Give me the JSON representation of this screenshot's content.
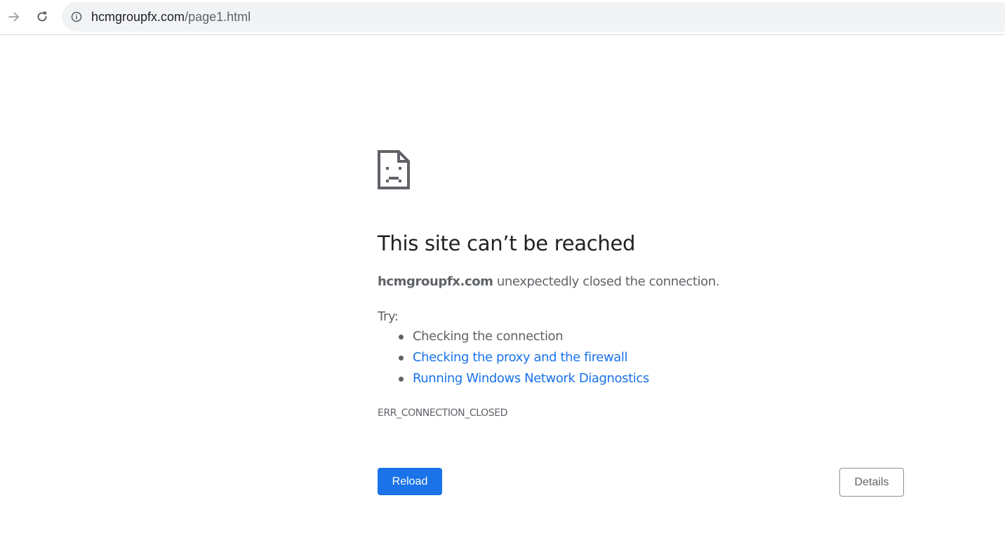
{
  "browser": {
    "url_host": "hcmgroupfx.com",
    "url_path": "/page1.html",
    "icons": {
      "forward": "arrow-right-icon",
      "reload": "reload-icon",
      "site_info": "info-icon"
    }
  },
  "error_page": {
    "icon": "sad-document-icon",
    "heading": "This site can’t be reached",
    "summary_host": "hcmgroupfx.com",
    "summary_text": " unexpectedly closed the connection.",
    "try_label": "Try:",
    "suggestions": [
      {
        "text": "Checking the connection",
        "is_link": false
      },
      {
        "text": "Checking the proxy and the firewall",
        "is_link": true
      },
      {
        "text": "Running Windows Network Diagnostics",
        "is_link": true
      }
    ],
    "error_code": "ERR_CONNECTION_CLOSED",
    "reload_label": "Reload",
    "details_label": "Details"
  },
  "colors": {
    "primary_blue": "#1a73e8",
    "text_gray": "#5f6368",
    "heading_dark": "#202124",
    "omnibox_bg": "#f1f3f4"
  }
}
